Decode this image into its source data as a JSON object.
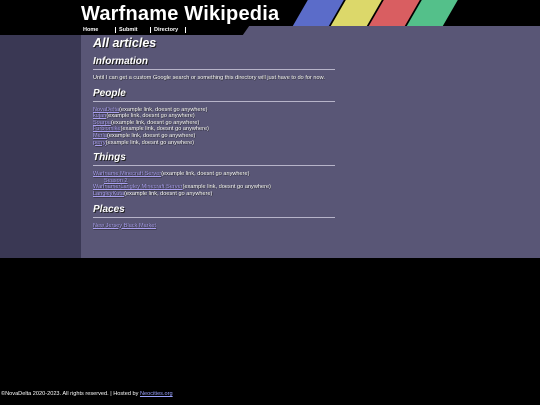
{
  "site": {
    "title": "Warfname Wikipedia",
    "stripe_colors": [
      "#5b6cc9",
      "#dcd86a",
      "#d95e61",
      "#54c08a"
    ]
  },
  "nav": {
    "items": [
      {
        "label": "Home"
      },
      {
        "label": "Submit"
      },
      {
        "label": "Directory"
      }
    ]
  },
  "page": {
    "title": "All articles"
  },
  "sections": {
    "information": {
      "heading": "Information",
      "text": "Until I can get a custom Google search or something this directory will just have to do for now."
    },
    "people": {
      "heading": "People",
      "entries": [
        {
          "link": "NovaDelta",
          "note": "(example link, doesnt go anywhere)"
        },
        {
          "link": "kujan",
          "note": "(example link, doesnt go anywhere)"
        },
        {
          "link": "Soarpa",
          "note": "(example link, doesnt go anywhere)"
        },
        {
          "link": "Furbiomike",
          "note": "(example link, doesnt go anywhere)"
        },
        {
          "link": "Merla",
          "note": "(example link, doesnt go anywhere)"
        },
        {
          "link": "perry",
          "note": "(example link, doesnt go anywhere)"
        }
      ]
    },
    "things": {
      "heading": "Things",
      "entries": [
        {
          "link": "Warfname Minecraft Server",
          "note": "(example link, doesnt go anywhere)"
        },
        {
          "link": "Season 2",
          "note": "",
          "sub": true
        },
        {
          "link": "WarfnamerLangley Minecraft Server",
          "note": "(example link, doesnt go anywhere)"
        },
        {
          "link": "LangleyKuta",
          "note": "(example link, doesnt go anywhere)"
        }
      ]
    },
    "places": {
      "heading": "Places",
      "entries": [
        {
          "link": "New Jersey Black Market",
          "note": ""
        }
      ]
    }
  },
  "footer": {
    "text": "©NovaDelta 2020-2023. All rights reserved. | Hosted by ",
    "host_link": "Neocities.org"
  }
}
